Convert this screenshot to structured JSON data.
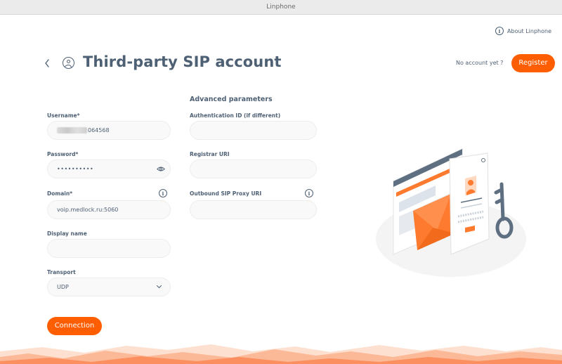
{
  "window": {
    "title": "Linphone"
  },
  "header": {
    "about_label": "About Linphone",
    "page_title": "Third-party SIP account",
    "no_account_text": "No account yet ?",
    "register_label": "Register"
  },
  "form": {
    "username": {
      "label": "Username*",
      "value_visible_suffix": "064568"
    },
    "password": {
      "label": "Password*",
      "value": "••••••••••"
    },
    "domain": {
      "label": "Domain*",
      "value": "voip.medlock.ru:5060"
    },
    "display_name": {
      "label": "Display name",
      "value": ""
    },
    "transport": {
      "label": "Transport",
      "selected": "UDP"
    },
    "connection_label": "Connection"
  },
  "advanced": {
    "title": "Advanced parameters",
    "auth_id": {
      "label": "Authentication ID (if different)",
      "value": ""
    },
    "registrar": {
      "label": "Registrar URI",
      "value": ""
    },
    "proxy": {
      "label": "Outbound SIP Proxy URI",
      "value": ""
    }
  },
  "icons": {
    "back": "chevron-left-icon",
    "account": "user-circle-icon",
    "info": "info-icon",
    "eye": "eye-icon",
    "dropdown": "chevron-down-icon"
  },
  "colors": {
    "accent": "#fe5e00",
    "text": "#4e6074",
    "field_bg": "#f9f9f9"
  }
}
